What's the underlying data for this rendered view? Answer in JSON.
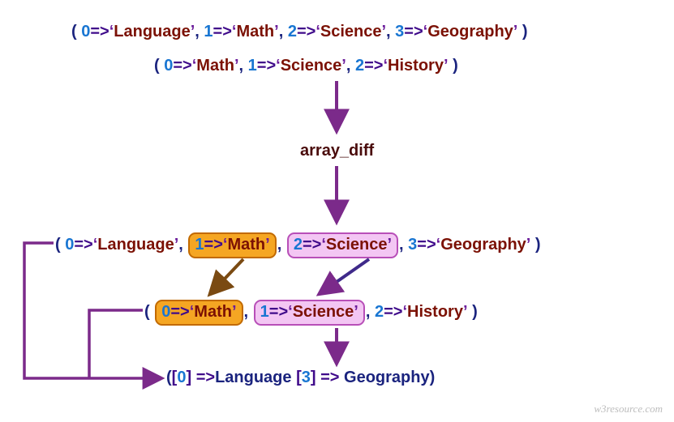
{
  "array1": {
    "pairs": [
      {
        "key": "0",
        "value": "Language"
      },
      {
        "key": "1",
        "value": "Math"
      },
      {
        "key": "2",
        "value": "Science"
      },
      {
        "key": "3",
        "value": "Geography"
      }
    ]
  },
  "array2": {
    "pairs": [
      {
        "key": "0",
        "value": "Math"
      },
      {
        "key": "1",
        "value": "Science"
      },
      {
        "key": "2",
        "value": "History"
      }
    ]
  },
  "function_name": "array_diff",
  "middle_array1": {
    "pairs": [
      {
        "key": "0",
        "value": "Language",
        "highlight": "none"
      },
      {
        "key": "1",
        "value": "Math",
        "highlight": "orange"
      },
      {
        "key": "2",
        "value": "Science",
        "highlight": "pink"
      },
      {
        "key": "3",
        "value": "Geography",
        "highlight": "none"
      }
    ]
  },
  "middle_array2": {
    "pairs": [
      {
        "key": "0",
        "value": "Math",
        "highlight": "orange"
      },
      {
        "key": "1",
        "value": "Science",
        "highlight": "pink"
      },
      {
        "key": "2",
        "value": "History",
        "highlight": "none"
      }
    ]
  },
  "result": {
    "pairs": [
      {
        "key": "0",
        "value": "Language"
      },
      {
        "key": "3",
        "value": "Geography"
      }
    ]
  },
  "watermark": "w3resource.com",
  "colors": {
    "orange_fill": "#f5a623",
    "orange_border": "#c26a00",
    "pink_fill": "#f3c6f3",
    "pink_border": "#b84fb8",
    "purple_arrow": "#7b2a8a",
    "brown_arrow": "#7a4a12"
  }
}
